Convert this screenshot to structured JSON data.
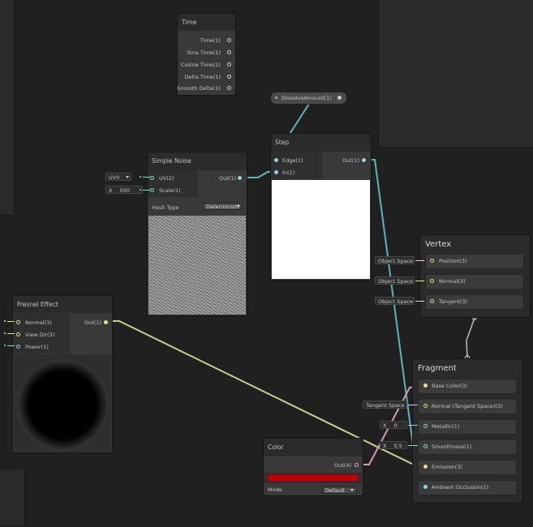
{
  "time_node": {
    "title": "Time",
    "outputs": [
      "Time(1)",
      "Sine Time(1)",
      "Cosine Time(1)",
      "Delta Time(1)",
      "Smooth Delta(1)"
    ]
  },
  "dissolve_property": {
    "label": "DissolveAmount(1)"
  },
  "step_node": {
    "title": "Step",
    "inputs": [
      "Edge(1)",
      "In(1)"
    ],
    "output": "Out(1)"
  },
  "simple_noise_node": {
    "title": "Simple Noise",
    "inputs": [
      "UV(2)",
      "Scale(1)"
    ],
    "output": "Out(1)",
    "uv_value": "UV0",
    "scale_axis": "X",
    "scale_value": "500",
    "hash_type_label": "Hash Type",
    "hash_type_value": "Deterministi"
  },
  "fresnel_node": {
    "title": "Fresnel Effect",
    "inputs": [
      "Normal(3)",
      "View Dir(3)",
      "Power(1)"
    ],
    "output": "Out(1)"
  },
  "vertex_stack": {
    "title": "Vertex",
    "space_label": "Object Space",
    "slots": [
      "Position(3)",
      "Normal(3)",
      "Tangent(3)"
    ]
  },
  "fragment_stack": {
    "title": "Fragment",
    "tangent_space_label": "Tangent Space",
    "slots": [
      "Base Color(3)",
      "Normal (Tangent Space)(3)",
      "Metallic(1)",
      "Smoothness(1)",
      "Emission(3)",
      "Ambient Occlusion(1)"
    ],
    "metallic_axis": "X",
    "metallic_value": "0",
    "smoothness_axis": "X",
    "smoothness_value": "0.5"
  },
  "color_node": {
    "title": "Color",
    "output": "Out(4)",
    "swatch_color": "#c00000",
    "mode_label": "Mode",
    "mode_value": "Default"
  },
  "colors": {
    "background": "#202020",
    "wire_teal": "#5fb3bf",
    "wire_yellow": "#cfcf8a",
    "wire_pink": "#d59ab8"
  }
}
